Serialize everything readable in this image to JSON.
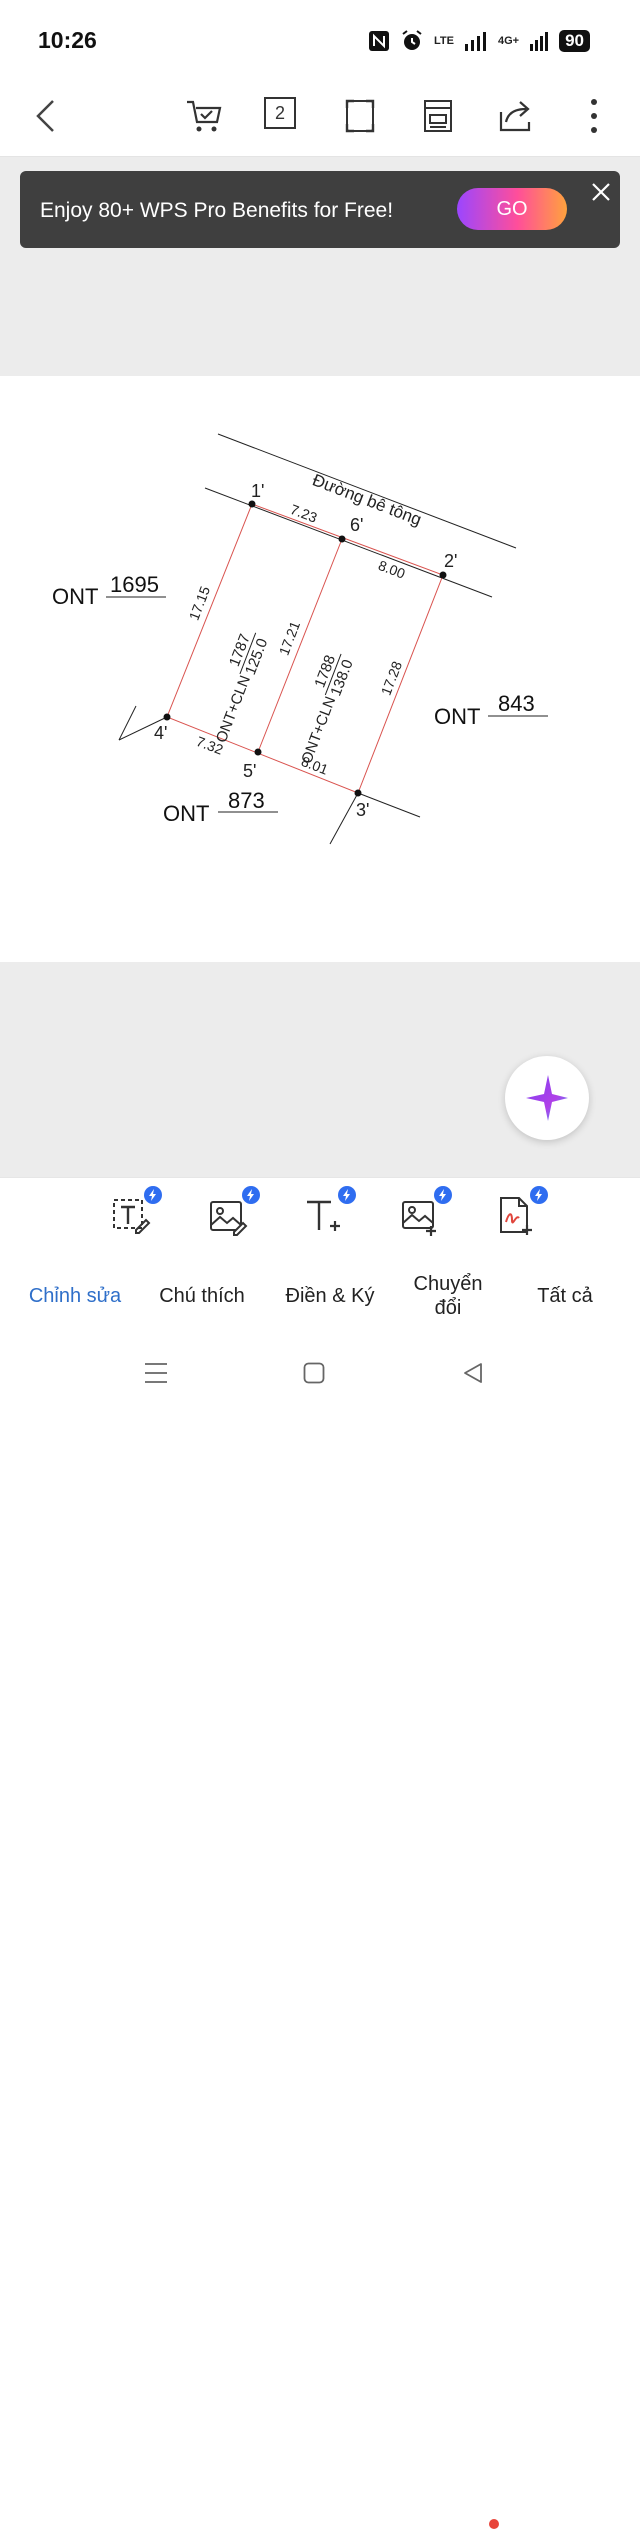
{
  "status": {
    "time": "10:26",
    "network": "LTE",
    "network_type": "4G+",
    "battery": "90"
  },
  "toolbar": {
    "page_count": "2"
  },
  "promo": {
    "text": "Enjoy 80+ WPS Pro Benefits for Free!",
    "button": "GO"
  },
  "plan": {
    "road_label": "Đường bê tông",
    "points": {
      "p1": "1'",
      "p2": "2'",
      "p3": "3'",
      "p4": "4'",
      "p5": "5'",
      "p6": "6'"
    },
    "edges": {
      "e1_6": "7.23",
      "e6_2": "8.00",
      "e2_3": "17.28",
      "e4_5": "7.32",
      "e5_3": "8.01",
      "e1_4": "17.15",
      "e6_5": "17.21"
    },
    "lots": {
      "lot1_name": "ONT+CLN",
      "lot1_number": "1787",
      "lot1_area": "125.0",
      "lot2_name": "ONT+CLN",
      "lot2_number": "1788",
      "lot2_area": "138.0"
    },
    "neighbors": {
      "left_type": "ONT",
      "left_num": "1695",
      "right_type": "ONT",
      "right_num": "843",
      "bottom_type": "ONT",
      "bottom_num": "873"
    }
  },
  "edit_tools": [
    "Edit text",
    "Edit image",
    "Add text",
    "Add image",
    "Sign / Fill"
  ],
  "tabs": {
    "edit": "Chỉnh sửa",
    "annotate": "Chú thích",
    "fill_sign": "Điền & Ký",
    "convert": "Chuyển đổi",
    "all": "Tất cả"
  },
  "colors": {
    "accent": "#2f6fc9",
    "promo_bg": "#3f3f3f",
    "boundary": "#d9534f",
    "badge": "#2f6df0"
  }
}
